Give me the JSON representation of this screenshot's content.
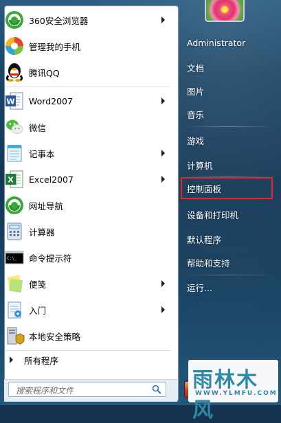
{
  "start_menu": {
    "left_items": [
      {
        "label": "360安全浏览器",
        "icon": "360-browser-icon",
        "has_submenu": true
      },
      {
        "label": "管理我的手机",
        "icon": "phone-manager-icon",
        "has_submenu": false
      },
      {
        "label": "腾讯QQ",
        "icon": "qq-penguin-icon",
        "has_submenu": false
      },
      {
        "label": "Word2007",
        "icon": "word-icon",
        "has_submenu": true
      },
      {
        "label": "微信",
        "icon": "wechat-icon",
        "has_submenu": false
      },
      {
        "label": "记事本",
        "icon": "notepad-icon",
        "has_submenu": true
      },
      {
        "label": "Excel2007",
        "icon": "excel-icon",
        "has_submenu": true
      },
      {
        "label": "网址导航",
        "icon": "web-nav-icon",
        "has_submenu": false
      },
      {
        "label": "计算器",
        "icon": "calculator-icon",
        "has_submenu": false
      },
      {
        "label": "命令提示符",
        "icon": "cmd-icon",
        "has_submenu": false
      },
      {
        "label": "便笺",
        "icon": "sticky-notes-icon",
        "has_submenu": true
      },
      {
        "label": "入门",
        "icon": "getting-started-icon",
        "has_submenu": true
      },
      {
        "label": "本地安全策略",
        "icon": "security-policy-icon",
        "has_submenu": false
      }
    ],
    "all_programs_label": "所有程序",
    "search_placeholder": "搜索程序和文件",
    "user_name": "Administrator",
    "right_items": [
      {
        "label": "文档"
      },
      {
        "label": "图片"
      },
      {
        "label": "音乐"
      },
      {
        "label": "游戏"
      },
      {
        "label": "计算机"
      },
      {
        "label": "控制面板",
        "highlighted": true
      },
      {
        "label": "设备和打印机"
      },
      {
        "label": "默认程序"
      },
      {
        "label": "帮助和支持"
      },
      {
        "label": "运行..."
      }
    ],
    "highlight_color": "#e0282a"
  },
  "watermark": {
    "main": "雨林木风",
    "sub": "WWW.YLMFU.COM"
  }
}
